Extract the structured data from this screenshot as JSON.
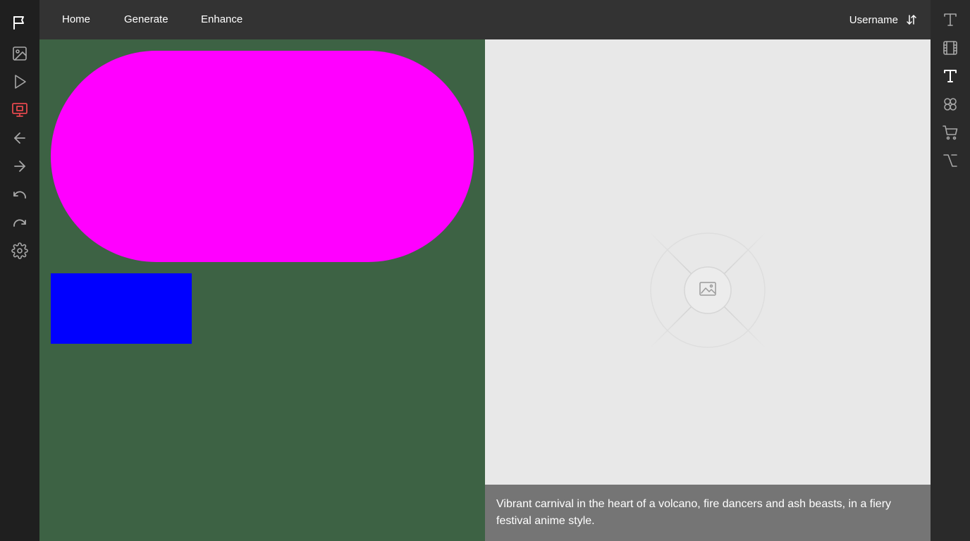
{
  "topbar": {
    "nav": [
      {
        "label": "Home"
      },
      {
        "label": "Generate"
      },
      {
        "label": "Enhance"
      }
    ],
    "username": "Username"
  },
  "left_rail": {
    "items": [
      {
        "icon": "flag-icon"
      },
      {
        "icon": "image-icon"
      },
      {
        "icon": "play-icon"
      },
      {
        "icon": "presentation-icon",
        "active": true,
        "color": "#e5484d"
      },
      {
        "icon": "arrow-left-icon"
      },
      {
        "icon": "arrow-right-icon"
      },
      {
        "icon": "undo-icon"
      },
      {
        "icon": "redo-icon"
      },
      {
        "icon": "settings-icon"
      }
    ]
  },
  "right_rail": {
    "items": [
      {
        "icon": "text-icon"
      },
      {
        "icon": "film-icon"
      },
      {
        "icon": "text-icon",
        "active": true
      },
      {
        "icon": "clover-icon"
      },
      {
        "icon": "cart-icon"
      },
      {
        "icon": "option-key-icon"
      }
    ]
  },
  "canvas": {
    "background": "#3d6244",
    "shapes": [
      {
        "type": "pill",
        "color": "#ff00ff"
      },
      {
        "type": "rectangle",
        "color": "#0000ff"
      }
    ]
  },
  "preview": {
    "background": "#e8e8e8",
    "placeholder_icon": "image-placeholder-icon",
    "caption": "Vibrant carnival in the heart of a volcano, fire dancers and ash beasts, in a fiery festival anime style."
  }
}
